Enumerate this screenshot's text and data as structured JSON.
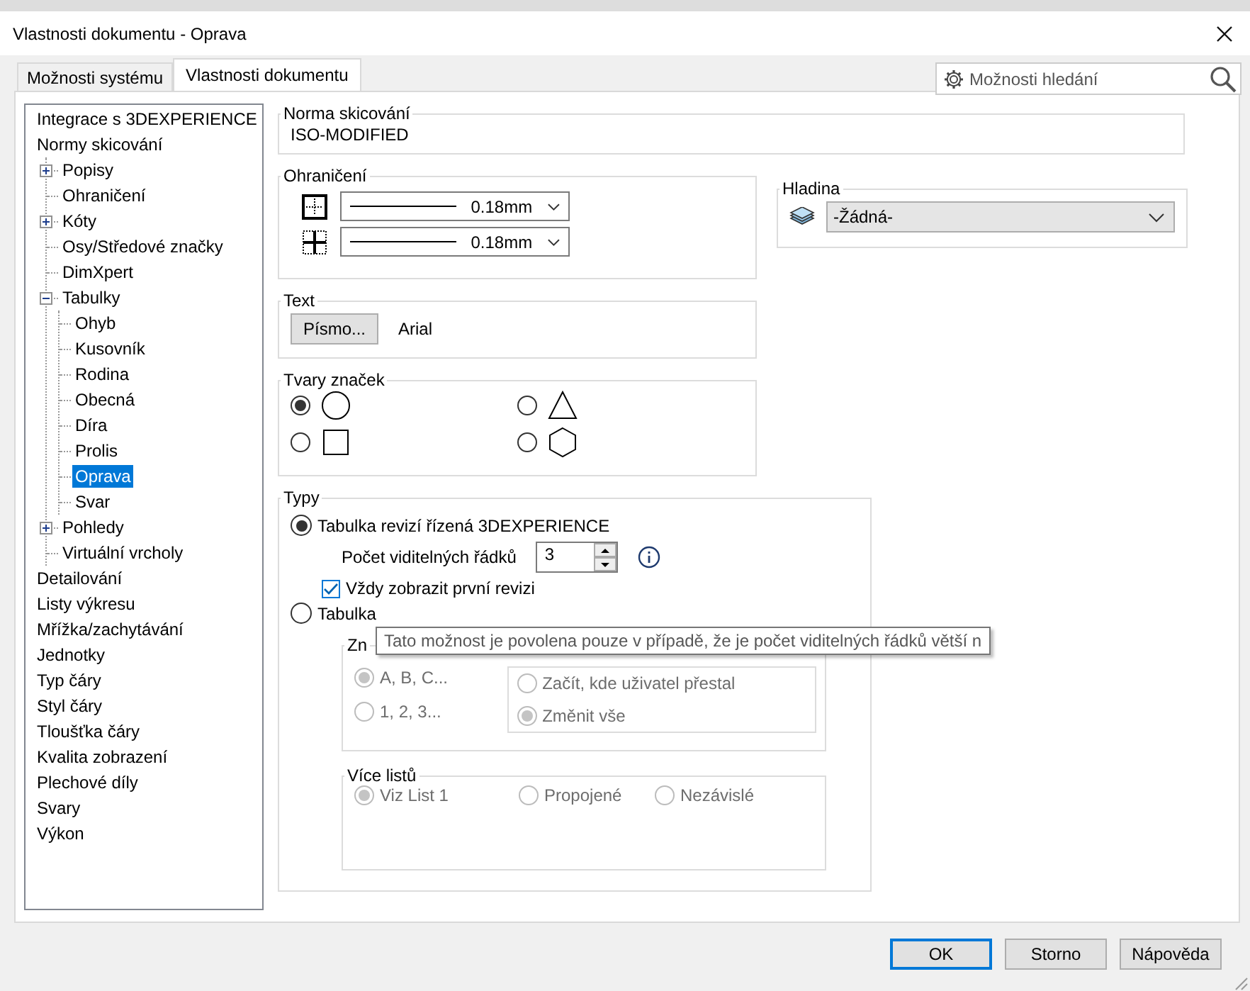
{
  "window": {
    "title": "Vlastnosti dokumentu - Oprava"
  },
  "tabs": [
    {
      "label": "Možnosti systému",
      "selected": false
    },
    {
      "label": "Vlastnosti dokumentu",
      "selected": true
    }
  ],
  "search": {
    "placeholder": "Možnosti hledání"
  },
  "tree": [
    {
      "label": "Integrace s 3DEXPERIENCE",
      "selected": false
    },
    {
      "label": "Normy skicování",
      "selected": false,
      "children": [
        {
          "label": "Popisy",
          "selected": false,
          "expanded": false
        },
        {
          "label": "Ohraničení",
          "selected": false
        },
        {
          "label": "Kóty",
          "selected": false,
          "expanded": false
        },
        {
          "label": "Osy/Středové  značky",
          "selected": false
        },
        {
          "label": "DimXpert",
          "selected": false
        },
        {
          "label": "Tabulky",
          "selected": false,
          "expanded": true,
          "children": [
            {
              "label": "Ohyb",
              "selected": false
            },
            {
              "label": "Kusovník",
              "selected": false
            },
            {
              "label": "Rodina",
              "selected": false
            },
            {
              "label": "Obecná",
              "selected": false
            },
            {
              "label": "Díra",
              "selected": false
            },
            {
              "label": "Prolis",
              "selected": false
            },
            {
              "label": "Oprava",
              "selected": true
            },
            {
              "label": "Svar",
              "selected": false
            }
          ]
        },
        {
          "label": "Pohledy",
          "selected": false,
          "expanded": false
        },
        {
          "label": "Virtuální vrcholy",
          "selected": false
        }
      ]
    },
    {
      "label": "Detailování",
      "selected": false
    },
    {
      "label": "Listy výkresu",
      "selected": false
    },
    {
      "label": "Mřížka/zachytávání",
      "selected": false
    },
    {
      "label": "Jednotky",
      "selected": false
    },
    {
      "label": "Typ čáry",
      "selected": false
    },
    {
      "label": "Styl čáry",
      "selected": false
    },
    {
      "label": "Tloušťka čáry",
      "selected": false
    },
    {
      "label": "Kvalita zobrazení",
      "selected": false
    },
    {
      "label": "Plechové díly",
      "selected": false
    },
    {
      "label": "Svary",
      "selected": false
    },
    {
      "label": "Výkon",
      "selected": false
    }
  ],
  "standard": {
    "title": "Norma skicování",
    "value": "ISO-MODIFIED"
  },
  "border": {
    "title": "Ohraničení",
    "rows": [
      {
        "kind": "outer",
        "value": "0.18mm"
      },
      {
        "kind": "inner",
        "value": "0.18mm"
      }
    ]
  },
  "text": {
    "title": "Text",
    "button": "Písmo...",
    "font": "Arial"
  },
  "shapes": {
    "title": "Tvary značek",
    "options": [
      {
        "kind": "circle",
        "selected": true
      },
      {
        "kind": "triangle",
        "selected": false
      },
      {
        "kind": "square",
        "selected": false
      },
      {
        "kind": "hexagon",
        "selected": false
      }
    ]
  },
  "layer": {
    "title": "Hladina",
    "value": "-Žádná-"
  },
  "types": {
    "title": "Typy",
    "option_1": {
      "label": "Tabulka revizí řízená 3DEXPERIENCE",
      "selected": true
    },
    "rows_label": "Počet viditelných řádků",
    "rows_value": "3",
    "checkbox": {
      "label": "Vždy zobrazit první revizi",
      "checked": true
    },
    "option_2": {
      "label": "Tabulka",
      "selected": false
    },
    "marking": {
      "title": "Zn",
      "options": [
        {
          "label": "A, B, C...",
          "selected": true,
          "disabled": true
        },
        {
          "label": "1, 2, 3...",
          "selected": false,
          "disabled": true
        }
      ],
      "change_options": [
        {
          "label": "Začít, kde uživatel přestal",
          "selected": false,
          "disabled": true
        },
        {
          "label": "Změnit vše",
          "selected": true,
          "disabled": true
        }
      ]
    },
    "sheets": {
      "title": "Více listů",
      "options": [
        {
          "label": "Viz List 1",
          "selected": true,
          "disabled": true
        },
        {
          "label": "Propojené",
          "selected": false,
          "disabled": true
        },
        {
          "label": "Nezávislé",
          "selected": false,
          "disabled": true
        }
      ]
    }
  },
  "tooltip": "Tato možnost je povolena pouze v případě, že je počet viditelných řádků větší n",
  "buttons": [
    {
      "label": "OK",
      "default": true
    },
    {
      "label": "Storno",
      "default": false
    },
    {
      "label": "Nápověda",
      "default": false
    }
  ]
}
